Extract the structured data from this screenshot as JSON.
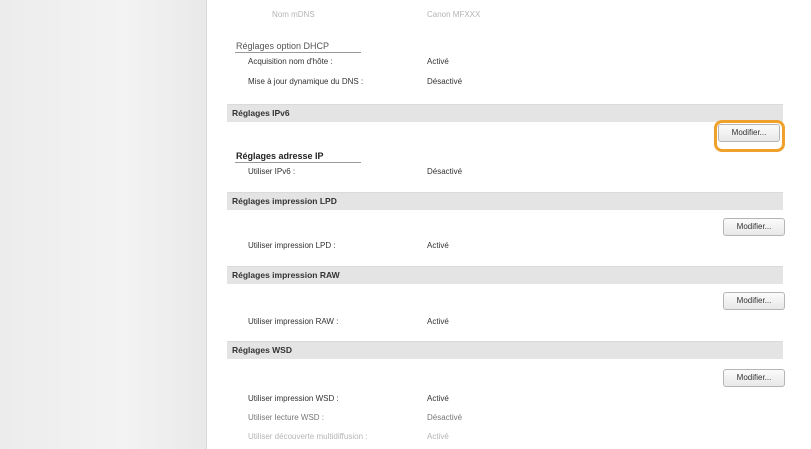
{
  "mdns": {
    "label": "Nom mDNS",
    "value": "Canon MFXXX"
  },
  "dhcp": {
    "title": "Réglages option DHCP",
    "rows": [
      {
        "label": "Acquisition nom d'hôte :",
        "value": "Activé"
      },
      {
        "label": "Mise à jour dynamique du DNS :",
        "value": "Désactivé"
      }
    ]
  },
  "ipv6": {
    "title": "Réglages IPv6",
    "button": "Modifier...",
    "sub_title": "Réglages adresse IP",
    "rows": [
      {
        "label": "Utiliser IPv6 :",
        "value": "Désactivé"
      }
    ]
  },
  "lpd": {
    "title": "Réglages impression LPD",
    "button": "Modifier...",
    "rows": [
      {
        "label": "Utiliser impression LPD :",
        "value": "Activé"
      }
    ]
  },
  "raw": {
    "title": "Réglages impression RAW",
    "button": "Modifier...",
    "rows": [
      {
        "label": "Utiliser impression RAW :",
        "value": "Activé"
      }
    ]
  },
  "wsd": {
    "title": "Réglages WSD",
    "button": "Modifier...",
    "rows": [
      {
        "label": "Utiliser impression WSD :",
        "value": "Activé"
      },
      {
        "label": "Utiliser lecture WSD :",
        "value": "Désactivé"
      },
      {
        "label": "Utiliser découverte multidiffusion :",
        "value": "Activé"
      }
    ]
  },
  "colors": {
    "highlight": "#f0a12c",
    "section_bar": "#e4e4e4"
  }
}
